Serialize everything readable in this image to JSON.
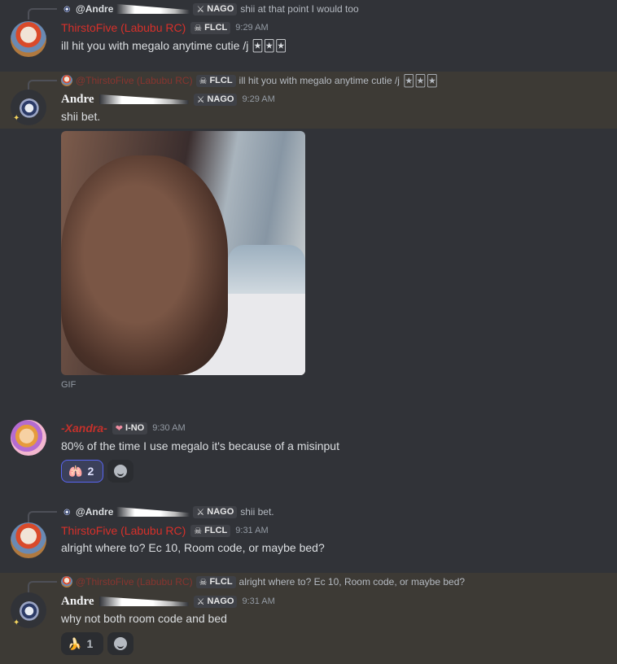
{
  "messages": [
    {
      "reply": {
        "name": "@Andre",
        "tag": "NAGO",
        "text": "shii at that point I would too"
      },
      "author": "ThirstoFive (Labubu RC)",
      "tag": "FLCL",
      "time": "9:29 AM",
      "text": "ill hit you with megalo anytime cutie /j"
    },
    {
      "reply": {
        "name": "@ThirstoFive (Labubu RC)",
        "tag": "FLCL",
        "text": "ill hit you with megalo anytime cutie /j"
      },
      "author": "Andre",
      "tag": "NAGO",
      "time": "9:29 AM",
      "text": "shii bet.",
      "attachment_label": "GIF"
    },
    {
      "author": "-Xandra-",
      "tag": "I-NO",
      "time": "9:30 AM",
      "text": "80% of the time I use megalo it's because of a misinput",
      "reaction": {
        "emoji": "lungs",
        "count": "2"
      }
    },
    {
      "reply": {
        "name": "@Andre",
        "tag": "NAGO",
        "text": "shii bet."
      },
      "author": "ThirstoFive (Labubu RC)",
      "tag": "FLCL",
      "time": "9:31 AM",
      "text": "alright where to? Ec 10, Room code, or maybe bed?"
    },
    {
      "reply": {
        "name": "@ThirstoFive (Labubu RC)",
        "tag": "FLCL",
        "text": "alright where to? Ec 10, Room code, or maybe bed?"
      },
      "author": "Andre",
      "tag": "NAGO",
      "time": "9:31 AM",
      "text": "why not both room code and bed",
      "reaction": {
        "emoji": "banana-dash",
        "count": "1"
      }
    }
  ],
  "colors": {
    "background": "#313338",
    "mention_highlight": "#3d3a35",
    "thirsto_name": "#d7302a",
    "reaction_active_border": "#5865f2"
  },
  "icons": {
    "sword_tag": "sword-icon",
    "skull_tag": "skull-icon",
    "heart_tag": "heart-icon",
    "add_reaction": "smile-icon"
  }
}
